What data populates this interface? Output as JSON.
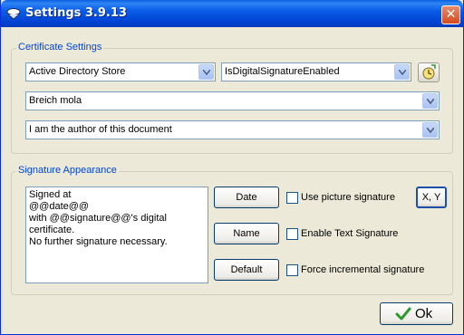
{
  "window": {
    "title": "Settings 3.9.13",
    "close_glyph": "✕"
  },
  "certificate_settings": {
    "legend": "Certificate Settings",
    "store_select": "Active Directory Store",
    "condition_select": "IsDigitalSignatureEnabled",
    "signer_select": "Breich mola",
    "reason_select": "I am the author of this document"
  },
  "signature_appearance": {
    "legend": "Signature Appearance",
    "text_lines": [
      "Signed at",
      "@@date@@",
      "with @@signature@@'s digital",
      "certificate.",
      "No further signature necessary."
    ],
    "date_button": "Date",
    "name_button": "Name",
    "default_button": "Default",
    "use_picture_label": "Use picture signature",
    "enable_text_label": "Enable Text Signature",
    "force_incremental_label": "Force incremental signature",
    "xy_button": "X, Y",
    "use_picture_checked": false,
    "enable_text_checked": false,
    "force_incremental_checked": false
  },
  "footer": {
    "ok_button": "Ok"
  },
  "icons": {
    "app": "app-icon",
    "tool": "certificate-tool-icon",
    "ok": "checkmark-icon"
  },
  "colors": {
    "title_bar": "#0a5ce8",
    "group_legend": "#0046d5",
    "check_green": "#2e9a2e"
  }
}
